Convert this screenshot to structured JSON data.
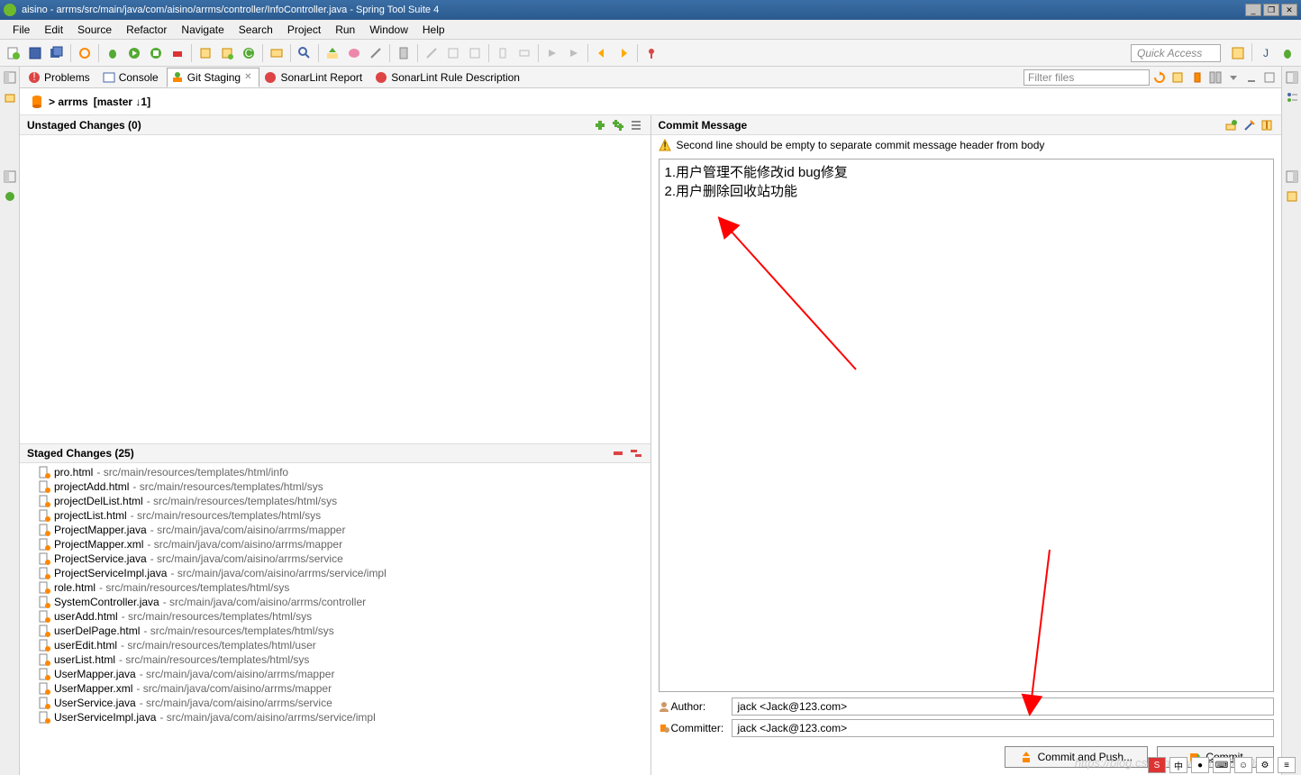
{
  "window": {
    "title": "aisino - arrms/src/main/java/com/aisino/arrms/controller/InfoController.java - Spring Tool Suite 4",
    "minimize": "_",
    "restore": "❐",
    "close": "✕"
  },
  "menu": [
    "File",
    "Edit",
    "Source",
    "Refactor",
    "Navigate",
    "Search",
    "Project",
    "Run",
    "Window",
    "Help"
  ],
  "quick_access": "Quick Access",
  "views": {
    "tabs": [
      {
        "label": "Problems",
        "active": false
      },
      {
        "label": "Console",
        "active": false
      },
      {
        "label": "Git Staging",
        "active": true,
        "closable": true
      },
      {
        "label": "SonarLint Report",
        "active": false
      },
      {
        "label": "SonarLint Rule Description",
        "active": false
      }
    ],
    "filter_placeholder": "Filter files"
  },
  "repo": {
    "name": "> arrms",
    "branch": "[master ↓1]"
  },
  "unstaged": {
    "title": "Unstaged Changes (0)"
  },
  "staged": {
    "title": "Staged Changes (25)",
    "items": [
      {
        "name": "pro.html",
        "path": "src/main/resources/templates/html/info"
      },
      {
        "name": "projectAdd.html",
        "path": "src/main/resources/templates/html/sys"
      },
      {
        "name": "projectDelList.html",
        "path": "src/main/resources/templates/html/sys"
      },
      {
        "name": "projectList.html",
        "path": "src/main/resources/templates/html/sys"
      },
      {
        "name": "ProjectMapper.java",
        "path": "src/main/java/com/aisino/arrms/mapper"
      },
      {
        "name": "ProjectMapper.xml",
        "path": "src/main/java/com/aisino/arrms/mapper"
      },
      {
        "name": "ProjectService.java",
        "path": "src/main/java/com/aisino/arrms/service"
      },
      {
        "name": "ProjectServiceImpl.java",
        "path": "src/main/java/com/aisino/arrms/service/impl"
      },
      {
        "name": "role.html",
        "path": "src/main/resources/templates/html/sys"
      },
      {
        "name": "SystemController.java",
        "path": "src/main/java/com/aisino/arrms/controller"
      },
      {
        "name": "userAdd.html",
        "path": "src/main/resources/templates/html/sys"
      },
      {
        "name": "userDelPage.html",
        "path": "src/main/resources/templates/html/sys"
      },
      {
        "name": "userEdit.html",
        "path": "src/main/resources/templates/html/user"
      },
      {
        "name": "userList.html",
        "path": "src/main/resources/templates/html/sys"
      },
      {
        "name": "UserMapper.java",
        "path": "src/main/java/com/aisino/arrms/mapper"
      },
      {
        "name": "UserMapper.xml",
        "path": "src/main/java/com/aisino/arrms/mapper"
      },
      {
        "name": "UserService.java",
        "path": "src/main/java/com/aisino/arrms/service"
      },
      {
        "name": "UserServiceImpl.java",
        "path": "src/main/java/com/aisino/arrms/service/impl"
      }
    ]
  },
  "commit": {
    "title": "Commit Message",
    "warning": "Second line should be empty to separate commit message header from body",
    "message": "1.用户管理不能修改id bug修复\n2.用户删除回收站功能",
    "author_label": "Author:",
    "author": "jack <Jack@123.com>",
    "committer_label": "Committer:",
    "committer": "jack <Jack@123.com>",
    "commit_push": "Commit and Push...",
    "commit_btn": "Commit"
  },
  "watermark": "https://blog.csdn.net/weixin_39040527"
}
